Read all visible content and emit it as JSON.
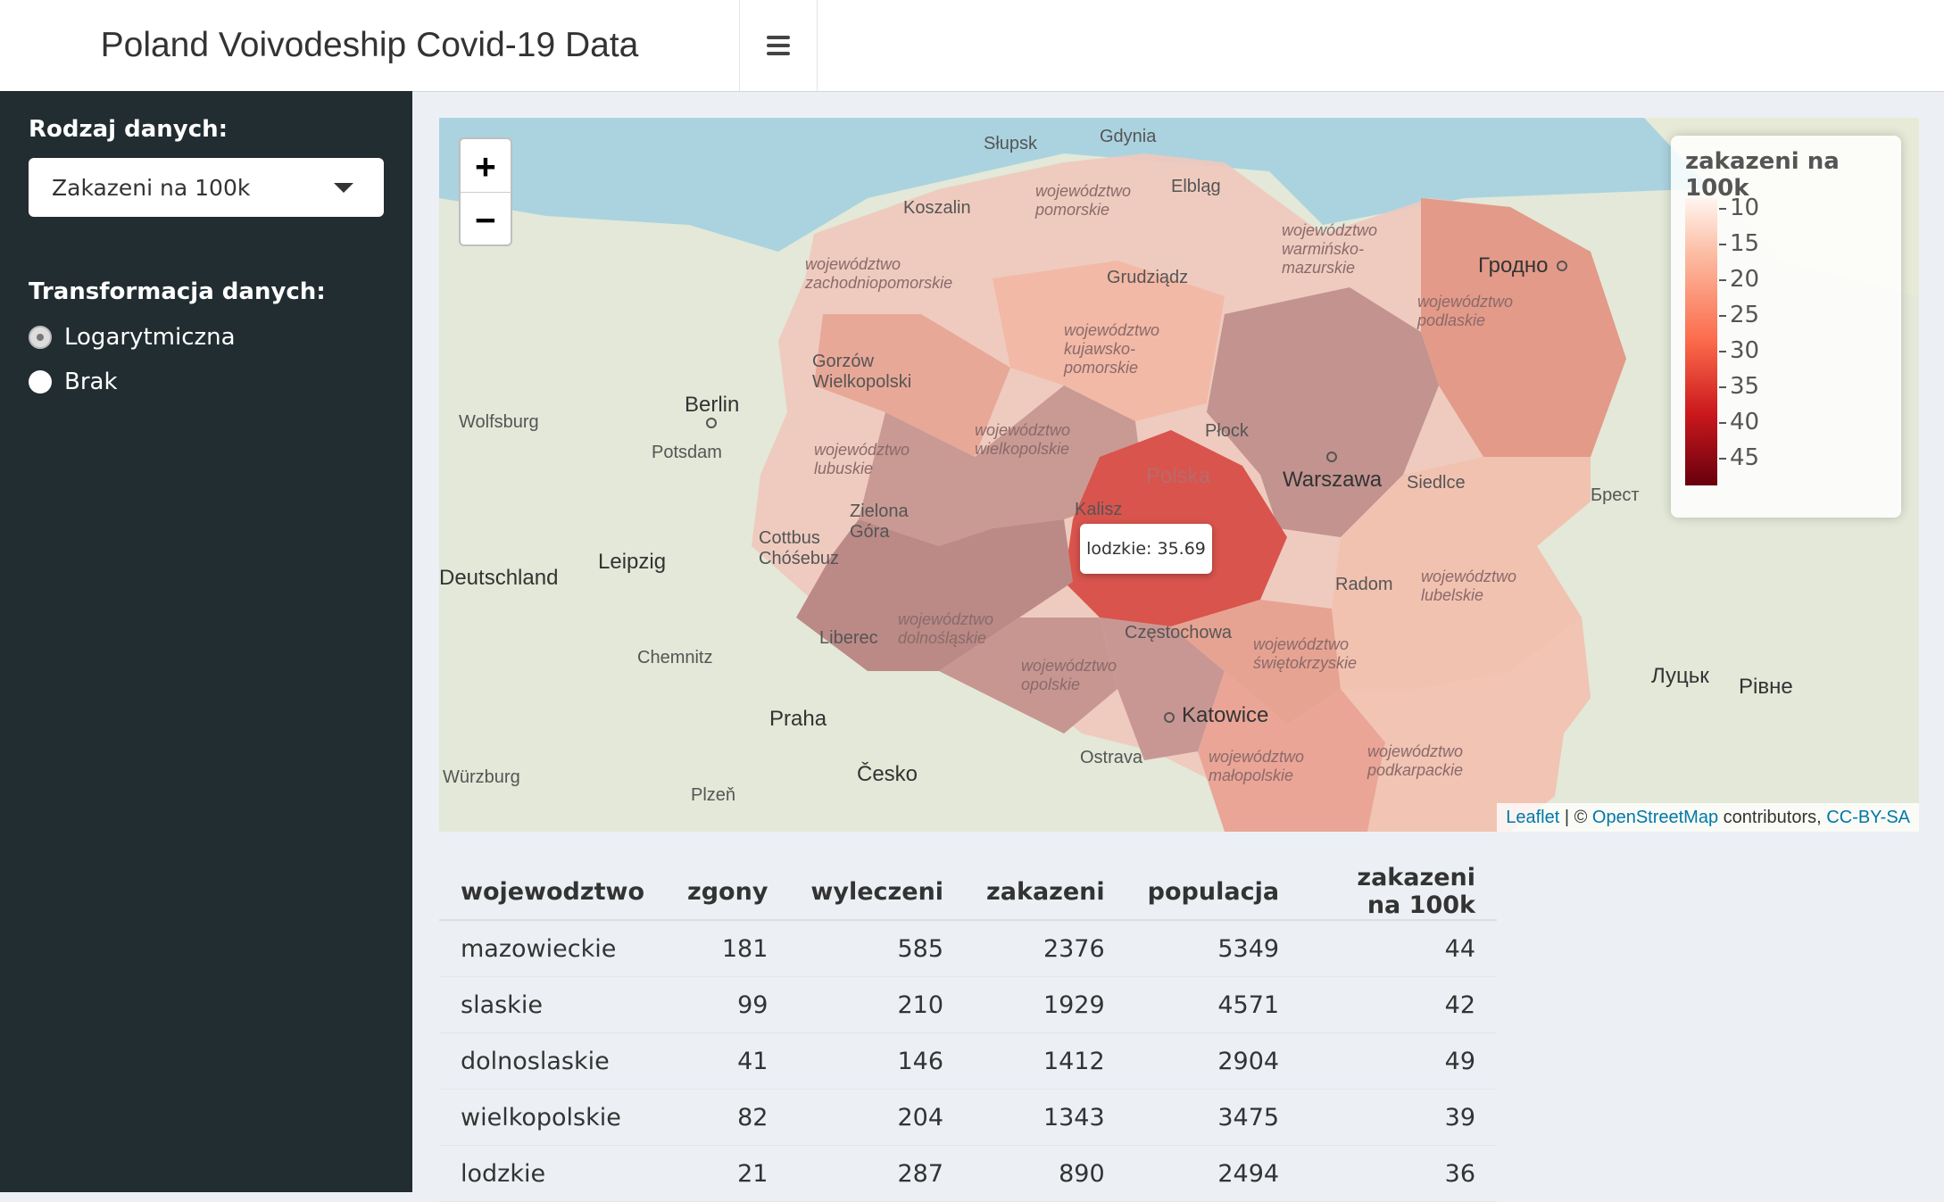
{
  "header": {
    "title": "Poland Voivodeship Covid-19 Data"
  },
  "sidebar": {
    "data_type_label": "Rodzaj danych:",
    "data_type_selected": "Zakazeni na 100k",
    "transform_label": "Transformacja danych:",
    "transform_options": [
      {
        "label": "Logarytmiczna",
        "checked": true
      },
      {
        "label": "Brak",
        "checked": false
      }
    ]
  },
  "map": {
    "zoom_in": "+",
    "zoom_out": "−",
    "legend": {
      "title": "zakazeni na 100k",
      "ticks": [
        "10",
        "15",
        "20",
        "25",
        "30",
        "35",
        "40",
        "45"
      ],
      "colors": [
        "#fff5f0",
        "#fcbba1",
        "#fb6a4a",
        "#cb181d",
        "#67000d"
      ]
    },
    "tooltip": "lodzkie: 35.69",
    "attribution": {
      "leaflet": "Leaflet",
      "sep1": " | © ",
      "osm": "OpenStreetMap",
      "contrib": " contributors, ",
      "license": "CC-BY-SA"
    },
    "labels": {
      "slupsk": "Słupsk",
      "gdynia": "Gdynia",
      "elblag": "Elbląg",
      "koszalin": "Koszalin",
      "grudziadz": "Grudziądz",
      "grodno": "Гродно",
      "gorzow": "Gorzów Wielkopolski",
      "berlin": "Berlin",
      "potsdam": "Potsdam",
      "wolfsburg": "Wolfsburg",
      "plock": "Płock",
      "warszawa": "Warszawa",
      "polska": "Polska",
      "kalisz": "Kalisz",
      "siedlce": "Siedlce",
      "brest": "Брест",
      "zielona": "Zielona Góra",
      "cottbus": "Cottbus Chóśebuz",
      "leipzig": "Leipzig",
      "deutschland": "Deutschland",
      "radom": "Radom",
      "liberec": "Liberec",
      "chemnitz": "Chemnitz",
      "czestochowa": "Częstochowa",
      "katowice": "Katowice",
      "praha": "Praha",
      "cesko": "Česko",
      "ostrava": "Ostrava",
      "plzen": "Plzeň",
      "wurzburg": "Würzburg",
      "lutsk": "Луцьк",
      "rivne": "Рівне",
      "woj_zach": "województwo zachodniopomorskie",
      "woj_pom": "województwo pomorskie",
      "woj_warm": "województwo warmińsko-mazurskie",
      "woj_podl": "województwo podlaskie",
      "woj_kuj": "województwo kujawsko-pomorskie",
      "woj_wielk": "województwo wielkopolskie",
      "woj_lub": "województwo lubuskie",
      "woj_lubel": "województwo lubelskie",
      "woj_doln": "województwo dolnośląskie",
      "woj_opol": "województwo opolskie",
      "woj_swiet": "województwo świętokrzyskie",
      "woj_malop": "województwo małopolskie",
      "woj_podk": "województwo podkarpackie"
    }
  },
  "table": {
    "headers": [
      "wojewodztwo",
      "zgony",
      "wyleczeni",
      "zakazeni",
      "populacja",
      "zakazeni na 100k"
    ],
    "rows": [
      [
        "mazowieckie",
        "181",
        "585",
        "2376",
        "5349",
        "44"
      ],
      [
        "slaskie",
        "99",
        "210",
        "1929",
        "4571",
        "42"
      ],
      [
        "dolnoslaskie",
        "41",
        "146",
        "1412",
        "2904",
        "49"
      ],
      [
        "wielkopolskie",
        "82",
        "204",
        "1343",
        "3475",
        "39"
      ],
      [
        "lodzkie",
        "21",
        "287",
        "890",
        "2494",
        "36"
      ]
    ]
  }
}
